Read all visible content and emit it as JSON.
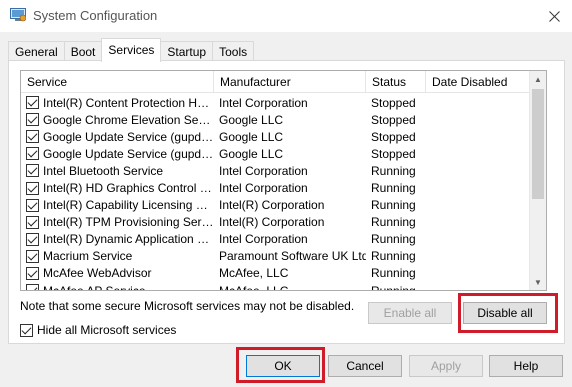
{
  "window": {
    "title": "System Configuration",
    "close_glyph": "✕",
    "icon": "msconfig-icon"
  },
  "tabs": [
    {
      "label": "General",
      "active": false
    },
    {
      "label": "Boot",
      "active": false
    },
    {
      "label": "Services",
      "active": true
    },
    {
      "label": "Startup",
      "active": false
    },
    {
      "label": "Tools",
      "active": false
    }
  ],
  "services_list": {
    "columns": [
      "Service",
      "Manufacturer",
      "Status",
      "Date Disabled"
    ],
    "rows": [
      {
        "checked": true,
        "service": "Intel(R) Content Protection HEC...",
        "manufacturer": "Intel Corporation",
        "status": "Stopped",
        "date_disabled": ""
      },
      {
        "checked": true,
        "service": "Google Chrome Elevation Servic...",
        "manufacturer": "Google LLC",
        "status": "Stopped",
        "date_disabled": ""
      },
      {
        "checked": true,
        "service": "Google Update Service (gupdate)",
        "manufacturer": "Google LLC",
        "status": "Stopped",
        "date_disabled": ""
      },
      {
        "checked": true,
        "service": "Google Update Service (gupdatem)",
        "manufacturer": "Google LLC",
        "status": "Stopped",
        "date_disabled": ""
      },
      {
        "checked": true,
        "service": "Intel Bluetooth Service",
        "manufacturer": "Intel Corporation",
        "status": "Running",
        "date_disabled": ""
      },
      {
        "checked": true,
        "service": "Intel(R) HD Graphics Control Pa...",
        "manufacturer": "Intel Corporation",
        "status": "Running",
        "date_disabled": ""
      },
      {
        "checked": true,
        "service": "Intel(R) Capability Licensing Ser...",
        "manufacturer": "Intel(R) Corporation",
        "status": "Running",
        "date_disabled": ""
      },
      {
        "checked": true,
        "service": "Intel(R) TPM Provisioning Service",
        "manufacturer": "Intel(R) Corporation",
        "status": "Running",
        "date_disabled": ""
      },
      {
        "checked": true,
        "service": "Intel(R) Dynamic Application Loa...",
        "manufacturer": "Intel Corporation",
        "status": "Running",
        "date_disabled": ""
      },
      {
        "checked": true,
        "service": "Macrium Service",
        "manufacturer": "Paramount Software UK Ltd",
        "status": "Running",
        "date_disabled": ""
      },
      {
        "checked": true,
        "service": "McAfee WebAdvisor",
        "manufacturer": "McAfee, LLC",
        "status": "Running",
        "date_disabled": ""
      },
      {
        "checked": true,
        "service": "McAfee AP Service",
        "manufacturer": "McAfee, LLC",
        "status": "Running",
        "date_disabled": ""
      }
    ]
  },
  "note": "Note that some secure Microsoft services may not be disabled.",
  "enable_all_label": "Enable all",
  "disable_all_label": "Disable all",
  "hide_ms": {
    "label": "Hide all Microsoft services",
    "checked": true
  },
  "footer": {
    "ok_label": "OK",
    "cancel_label": "Cancel",
    "apply_label": "Apply",
    "help_label": "Help"
  },
  "colors": {
    "highlight": "#d01c28",
    "dialog_bg": "#f0f0f0",
    "button_bg": "#e1e1e1",
    "default_button_border": "#0078d7"
  }
}
